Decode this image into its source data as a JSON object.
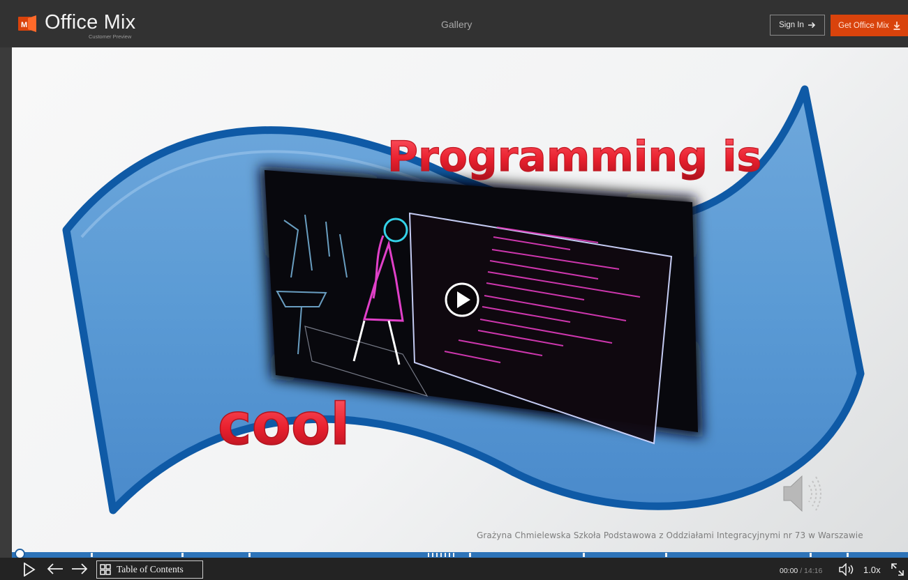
{
  "header": {
    "brand": "Office Mix",
    "brand_subtitle": "Customer Preview",
    "logo_letter": "M",
    "gallery_label": "Gallery",
    "sign_in_label": "Sign In",
    "get_office_mix_label": "Get Office Mix"
  },
  "slide": {
    "headline": "Programming is",
    "subword": "cool",
    "credit": "Grażyna Chmielewska Szkoła Podstawowa z Oddziałami Integracyjnymi nr 73 w Warszawie",
    "video_icon": "play-circle-icon",
    "audio_icon": "speaker-icon"
  },
  "player": {
    "progress_percent": 0,
    "table_of_contents_label": "Table of Contents",
    "time_current": "00:00",
    "time_separator": " / ",
    "time_total": "14:16",
    "speed": "1.0x"
  },
  "colors": {
    "accent_orange": "#d9430c",
    "progress_blue": "#2d73b8",
    "banner_blue": "#5b9bd5",
    "headline_red": "#e8202e"
  }
}
